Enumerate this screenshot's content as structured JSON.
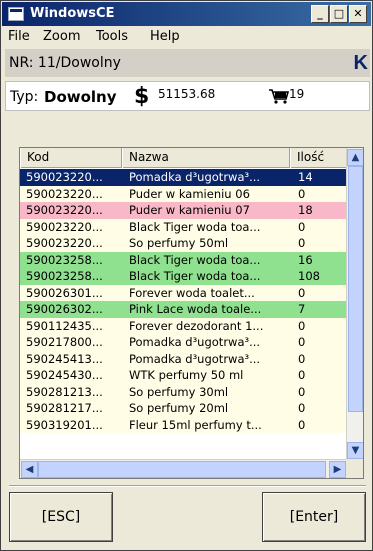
{
  "window": {
    "title": "WindowsCE",
    "minimize": "_",
    "maximize": "□",
    "close": "✕"
  },
  "menu": [
    "File",
    "Zoom",
    "Tools",
    "Help"
  ],
  "nr": {
    "text": "NR:  11/Dowolny",
    "logo": "K"
  },
  "typ": {
    "label": "Typ:",
    "value": "Dowolny",
    "currency_symbol": "$",
    "amount": "51153.68",
    "cart_icon": "cart-icon",
    "count": "19"
  },
  "table": {
    "columns": [
      "Kod",
      "Nazwa",
      "Ilość"
    ],
    "rows": [
      {
        "kod": "590023220...",
        "nazwa": "Pomadka d³ugotrwa³...",
        "ilosc": "14",
        "bg": "#0a246a",
        "fg": "#ffffff"
      },
      {
        "kod": "590023220...",
        "nazwa": "Puder w kamieniu 06",
        "ilosc": "0",
        "bg": "#fffde6",
        "fg": "#000000"
      },
      {
        "kod": "590023220...",
        "nazwa": "Puder w kamieniu 07",
        "ilosc": "18",
        "bg": "#f9b8c8",
        "fg": "#000000"
      },
      {
        "kod": "590023220...",
        "nazwa": "Black Tiger woda toa...",
        "ilosc": "0",
        "bg": "#fffde6",
        "fg": "#000000"
      },
      {
        "kod": "590023220...",
        "nazwa": "So perfumy 50ml",
        "ilosc": "0",
        "bg": "#fffde6",
        "fg": "#000000"
      },
      {
        "kod": "590023258...",
        "nazwa": "Black Tiger woda toa...",
        "ilosc": "16",
        "bg": "#8fe08f",
        "fg": "#000000"
      },
      {
        "kod": "590023258...",
        "nazwa": "Black Tiger woda toa...",
        "ilosc": "108",
        "bg": "#8fe08f",
        "fg": "#000000"
      },
      {
        "kod": "590026301...",
        "nazwa": "Forever woda toalet...",
        "ilosc": "0",
        "bg": "#fffde6",
        "fg": "#000000"
      },
      {
        "kod": "590026302...",
        "nazwa": "Pink Lace woda toale...",
        "ilosc": "7",
        "bg": "#8fe08f",
        "fg": "#000000"
      },
      {
        "kod": "590112435...",
        "nazwa": "Forever dezodorant 1...",
        "ilosc": "0",
        "bg": "#fffde6",
        "fg": "#000000"
      },
      {
        "kod": "590217800...",
        "nazwa": "Pomadka d³ugotrwa³...",
        "ilosc": "0",
        "bg": "#fffde6",
        "fg": "#000000"
      },
      {
        "kod": "590245413...",
        "nazwa": "Pomadka d³ugotrwa³...",
        "ilosc": "0",
        "bg": "#fffde6",
        "fg": "#000000"
      },
      {
        "kod": "590245430...",
        "nazwa": "WTK perfumy 50 ml",
        "ilosc": "0",
        "bg": "#fffde6",
        "fg": "#000000"
      },
      {
        "kod": "590281213...",
        "nazwa": "So perfumy 30ml",
        "ilosc": "0",
        "bg": "#fffde6",
        "fg": "#000000"
      },
      {
        "kod": "590281217...",
        "nazwa": "So perfumy 20ml",
        "ilosc": "0",
        "bg": "#fffde6",
        "fg": "#000000"
      },
      {
        "kod": "590319201...",
        "nazwa": "Fleur 15ml perfumy t...",
        "ilosc": "0",
        "bg": "#fffde6",
        "fg": "#000000"
      }
    ]
  },
  "buttons": {
    "esc": "[ESC]",
    "enter": "[Enter]"
  }
}
